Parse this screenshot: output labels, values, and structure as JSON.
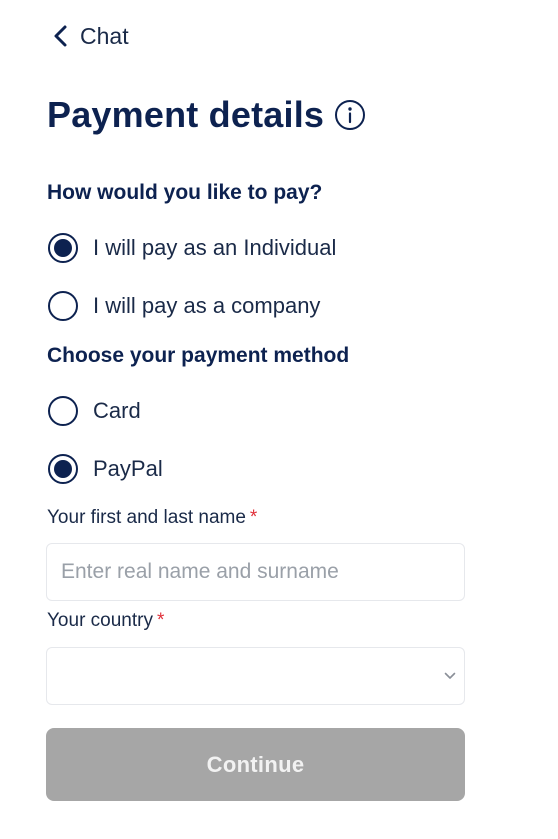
{
  "nav": {
    "back_label": "Chat",
    "back_icon": "chevron-left-icon"
  },
  "header": {
    "title": "Payment details",
    "info_icon": "info-icon"
  },
  "payer_section": {
    "question": "How would you like to pay?",
    "options": [
      {
        "label": "I will pay as an Individual",
        "selected": true
      },
      {
        "label": "I will pay as a company",
        "selected": false
      }
    ]
  },
  "method_section": {
    "question": "Choose your payment method",
    "options": [
      {
        "label": "Card",
        "selected": false
      },
      {
        "label": "PayPal",
        "selected": true
      }
    ]
  },
  "form": {
    "name_label": "Your first and last name",
    "name_required_mark": "*",
    "name_placeholder": "Enter real name and surname",
    "name_value": "",
    "country_label": "Your country",
    "country_required_mark": "*",
    "country_value": "",
    "country_icon": "chevron-down-icon"
  },
  "actions": {
    "continue_label": "Continue",
    "continue_enabled": false
  },
  "colors": {
    "primary": "#0d2250",
    "required": "#e0303a",
    "button_disabled": "#a6a6a6",
    "placeholder": "#9aa0a8"
  }
}
